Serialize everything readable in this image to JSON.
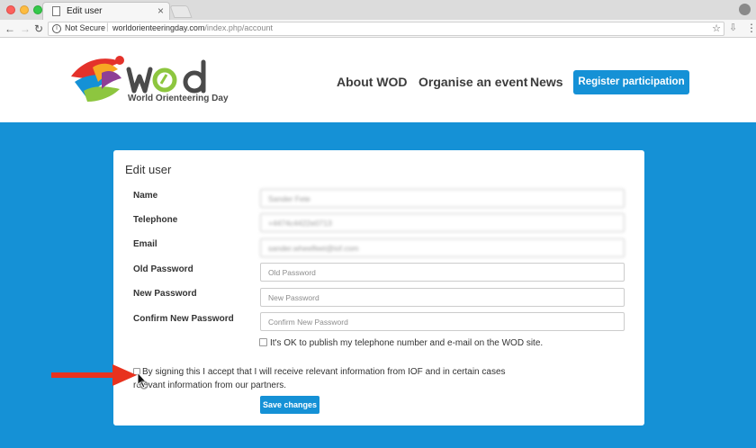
{
  "browser": {
    "tab_title": "Edit user",
    "not_secure": "Not Secure",
    "url_domain": "worldorienteeringday.com",
    "url_path": "/index.php/account"
  },
  "site": {
    "logo_text": "WOD",
    "logo_subtitle": "World Orienteering Day",
    "nav": {
      "about": "About WOD",
      "organise": "Organise an event",
      "news": "News",
      "register": "Register participation"
    },
    "colors": {
      "primary": "#1591d6"
    }
  },
  "form": {
    "title": "Edit user",
    "fields": {
      "name": {
        "label": "Name",
        "value": "Sander Fete"
      },
      "telephone": {
        "label": "Telephone",
        "value": "+4474c4422e0713"
      },
      "email": {
        "label": "Email",
        "value": "sander.wheelfeet@iof.com"
      },
      "old_password": {
        "label": "Old Password",
        "placeholder": "Old Password"
      },
      "new_password": {
        "label": "New Password",
        "placeholder": "New Password"
      },
      "confirm_password": {
        "label": "Confirm New Password",
        "placeholder": "Confirm New Password"
      }
    },
    "publish_checkbox": {
      "label": "It's OK to publish my telephone number and e-mail on the WOD site."
    },
    "iof_checkbox": {
      "label": "By signing this I accept that I will receive relevant information from IOF and in certain cases relevant information from our partners."
    },
    "save_label": "Save changes"
  }
}
